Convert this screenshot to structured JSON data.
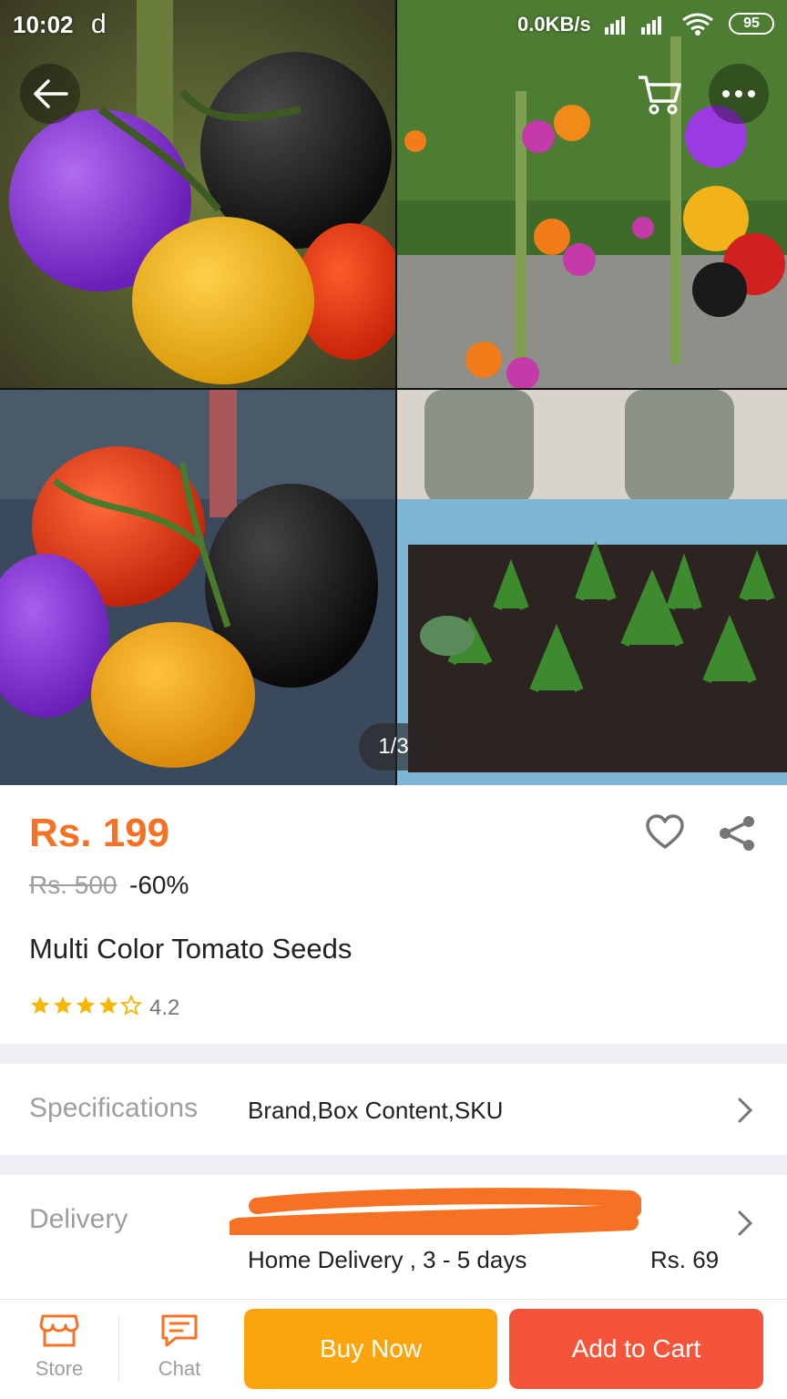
{
  "status_bar": {
    "time": "10:02",
    "app_indicator": "d",
    "network_speed": "0.0KB/s",
    "battery": "95"
  },
  "gallery": {
    "page_indicator": "1/3",
    "image_count": 4
  },
  "product": {
    "price": "Rs. 199",
    "original_price": "Rs. 500",
    "discount": "-60%",
    "title": "Multi Color Tomato Seeds",
    "rating": "4.2",
    "rating_stars": 4.2
  },
  "specifications": {
    "label": "Specifications",
    "value": "Brand,Box Content,SKU"
  },
  "delivery": {
    "label": "Delivery",
    "method": "Home Delivery , 3 - 5 days",
    "fee": "Rs. 69"
  },
  "bottom_bar": {
    "store_label": "Store",
    "chat_label": "Chat",
    "buy_now_label": "Buy Now",
    "add_to_cart_label": "Add to Cart"
  },
  "colors": {
    "accent": "#f57224",
    "buy_now": "#fca40e",
    "add_to_cart": "#f4553a",
    "star": "#f7b500"
  },
  "icons": [
    "back-arrow-icon",
    "cart-icon",
    "more-icon",
    "heart-icon",
    "share-icon",
    "chevron-right-icon",
    "store-icon",
    "chat-icon",
    "star-icon"
  ]
}
